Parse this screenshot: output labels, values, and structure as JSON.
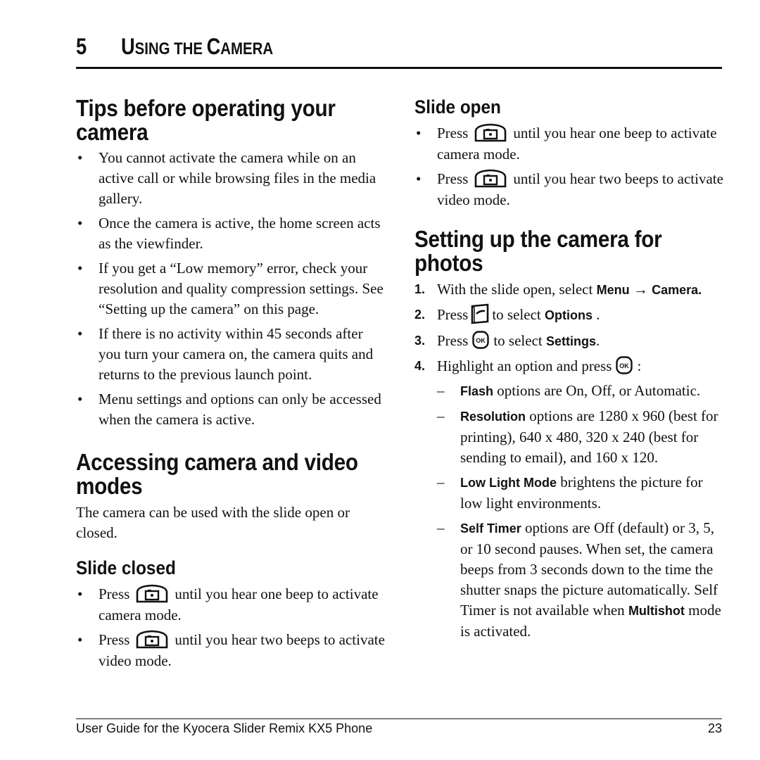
{
  "chapter": {
    "number": "5",
    "title_parts": [
      {
        "text": "U",
        "small": false
      },
      {
        "text": "SING THE ",
        "small": true
      },
      {
        "text": "C",
        "small": false
      },
      {
        "text": "AMERA",
        "small": true
      }
    ]
  },
  "left": {
    "tips": {
      "heading": "Tips before operating your camera",
      "bullets": [
        "You cannot activate the camera while on an active call or while browsing files in the media gallery.",
        "Once the camera is active, the home screen acts as the viewfinder.",
        "If you get a “Low memory” error, check your resolution and quality compression settings. See “Setting up the camera” on this page.",
        "If there is no activity within 45 seconds after you turn your camera on, the camera quits and returns to the previous launch point.",
        "Menu settings and options can only be accessed when the camera is active."
      ]
    },
    "accessing": {
      "heading": "Accessing camera and video modes",
      "intro": "The camera can be used with the slide open or closed."
    },
    "slide_closed": {
      "heading": "Slide closed",
      "items": [
        {
          "pre": "Press",
          "icon": "camera-key-icon",
          "post": "until you hear one beep to activate camera mode."
        },
        {
          "pre": "Press",
          "icon": "camera-key-icon",
          "post": "until you hear two beeps to activate video mode."
        }
      ]
    }
  },
  "right": {
    "slide_open": {
      "heading": "Slide open",
      "items": [
        {
          "pre": "Press",
          "icon": "camera-key-icon",
          "post": "until you hear one beep to activate camera mode."
        },
        {
          "pre": "Press",
          "icon": "camera-key-icon",
          "post": "until you hear two beeps to activate video mode."
        }
      ]
    },
    "setup": {
      "heading": "Setting up the camera for photos",
      "steps": [
        {
          "num": "1.",
          "text": "With the slide open, select ",
          "kw1": "Menu",
          "arrow": "→",
          "kw2": "Camera."
        },
        {
          "num": "2.",
          "pre": "Press",
          "icon": "left-softkey-icon",
          "mid": "to select ",
          "kw": "Options",
          "post": " ."
        },
        {
          "num": "3.",
          "pre": "Press",
          "icon": "ok-key-icon",
          "mid": "to select ",
          "kw": "Settings",
          "post": "."
        },
        {
          "num": "4.",
          "pre": "Highlight an option and press",
          "icon": "ok-key-icon",
          "post": ":"
        }
      ],
      "options": [
        {
          "dash": "–",
          "kw": "Flash",
          "text": " options are On, Off, or Automatic."
        },
        {
          "dash": "–",
          "kw": "Resolution",
          "text": " options are 1280 x 960 (best for printing), 640 x 480, 320 x 240 (best for sending to email), and 160 x 120."
        },
        {
          "dash": "–",
          "kw": "Low Light Mode",
          "text": " brightens the picture for low light environments."
        },
        {
          "dash": "–",
          "kw": "Self Timer",
          "text": " options are Off (default) or 3, 5, or 10 second pauses. When set, the camera beeps from 3 seconds down to the time the shutter snaps the picture automatically. Self Timer is not available when ",
          "kw2": "Multishot",
          "text2": " mode is activated."
        }
      ]
    }
  },
  "footer": {
    "title": "User Guide for the Kyocera Slider Remix KX5 Phone",
    "page": "23"
  }
}
